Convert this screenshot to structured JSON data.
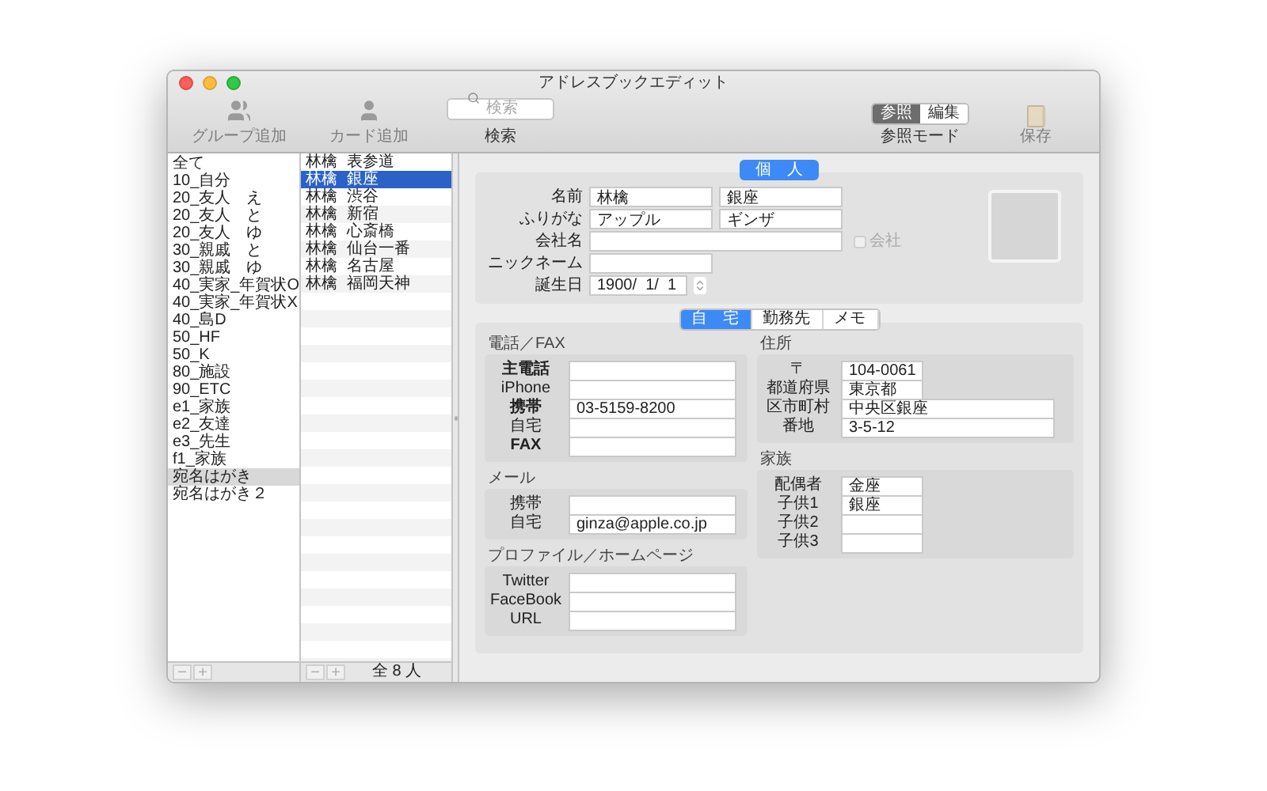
{
  "window": {
    "title": "アドレスブックエディット"
  },
  "toolbar": {
    "actions": [
      {
        "kind": "group-add",
        "label": "グループ追加",
        "disabled": true
      },
      {
        "kind": "card-add",
        "label": "カード追加",
        "disabled": true
      }
    ],
    "search": {
      "placeholder": "検索",
      "label": "検索"
    },
    "mode": {
      "label": "参照モード",
      "options": [
        {
          "label": "参照",
          "selected": true
        },
        {
          "label": "編集",
          "selected": false
        }
      ]
    },
    "save": {
      "label": "保存",
      "disabled": true
    }
  },
  "groups": [
    {
      "label": "全て",
      "selected": false
    },
    {
      "label": "10_自分",
      "selected": false
    },
    {
      "label": "20_友人　え",
      "selected": false
    },
    {
      "label": "20_友人　と",
      "selected": false
    },
    {
      "label": "20_友人　ゆ",
      "selected": false
    },
    {
      "label": "30_親戚　と",
      "selected": false
    },
    {
      "label": "30_親戚　ゆ",
      "selected": false
    },
    {
      "label": "40_実家_年賀状O",
      "selected": false
    },
    {
      "label": "40_実家_年賀状X",
      "selected": false
    },
    {
      "label": "40_島D",
      "selected": false
    },
    {
      "label": "50_HF",
      "selected": false
    },
    {
      "label": "50_K",
      "selected": false
    },
    {
      "label": "80_施設",
      "selected": false
    },
    {
      "label": "90_ETC",
      "selected": false
    },
    {
      "label": "e1_家族",
      "selected": false
    },
    {
      "label": "e2_友達",
      "selected": false
    },
    {
      "label": "e3_先生",
      "selected": false
    },
    {
      "label": "f1_家族",
      "selected": false
    },
    {
      "label": "宛名はがき",
      "selected": true
    },
    {
      "label": "宛名はがき２",
      "selected": false
    }
  ],
  "groups_footer": {
    "buttons": [
      "−",
      "+"
    ]
  },
  "cards": [
    {
      "family": "林檎",
      "given": "表参道",
      "selected": false
    },
    {
      "family": "林檎",
      "given": "銀座",
      "selected": true
    },
    {
      "family": "林檎",
      "given": "渋谷",
      "selected": false
    },
    {
      "family": "林檎",
      "given": "新宿",
      "selected": false
    },
    {
      "family": "林檎",
      "given": "心斎橋",
      "selected": false
    },
    {
      "family": "林檎",
      "given": "仙台一番",
      "selected": false
    },
    {
      "family": "林檎",
      "given": "名古屋",
      "selected": false
    },
    {
      "family": "林檎",
      "given": "福岡天神",
      "selected": false
    }
  ],
  "cards_footer": {
    "buttons": [
      "−",
      "+"
    ],
    "count": "全 8 人"
  },
  "person": {
    "tab": {
      "label": "個　人",
      "selected": true
    },
    "fields": [
      {
        "kind": "pair",
        "label": "名前",
        "values": [
          "林檎",
          "銀座"
        ]
      },
      {
        "kind": "pair",
        "label": "ふりがな",
        "values": [
          "アップル",
          "ギンザ"
        ]
      },
      {
        "kind": "wide",
        "label": "会社名",
        "checkbox": {
          "label": "会社",
          "checked": false,
          "disabled": true
        }
      },
      {
        "kind": "medium",
        "label": "ニックネーム"
      },
      {
        "kind": "date",
        "label": "誕生日",
        "values": [
          "1900/  1/  1"
        ]
      }
    ]
  },
  "contact_tabs": [
    {
      "label": "自　宅",
      "selected": true
    },
    {
      "label": "勤務先",
      "selected": false
    },
    {
      "label": "メモ",
      "selected": false
    }
  ],
  "columns": [
    [
      {
        "title": "電話／FAX",
        "rows": [
          {
            "label": "主電話",
            "bold": true
          },
          {
            "label": "iPhone",
            "bold": false
          },
          {
            "label": "携帯",
            "bold": true,
            "value": "03-5159-8200"
          },
          {
            "label": "自宅",
            "bold": false
          },
          {
            "label": "FAX",
            "bold": true
          }
        ]
      },
      {
        "title": "メール",
        "rows": [
          {
            "label": "携帯",
            "bold": false
          },
          {
            "label": "自宅",
            "bold": false,
            "value": "ginza@apple.co.jp"
          }
        ]
      },
      {
        "title": "プロファイル／ホームページ",
        "rows": [
          {
            "label": "Twitter",
            "bold": false
          },
          {
            "label": "FaceBook",
            "bold": false
          },
          {
            "label": "URL",
            "bold": false
          }
        ]
      }
    ],
    [
      {
        "title": "住所",
        "rows": [
          {
            "label": "〒",
            "kind": "short",
            "value": "104-0061"
          },
          {
            "label": "都道府県",
            "kind": "short",
            "value": "東京都"
          },
          {
            "label": "区市町村",
            "kind": "long",
            "value": "中央区銀座"
          },
          {
            "label": "番地",
            "kind": "long",
            "value": "3-5-12"
          }
        ]
      },
      {
        "title": "家族",
        "rows": [
          {
            "label": "配偶者",
            "kind": "short",
            "value": "金座"
          },
          {
            "label": "子供1",
            "kind": "short",
            "value": "銀座"
          },
          {
            "label": "子供2",
            "kind": "short"
          },
          {
            "label": "子供3",
            "kind": "short"
          }
        ]
      }
    ]
  ]
}
